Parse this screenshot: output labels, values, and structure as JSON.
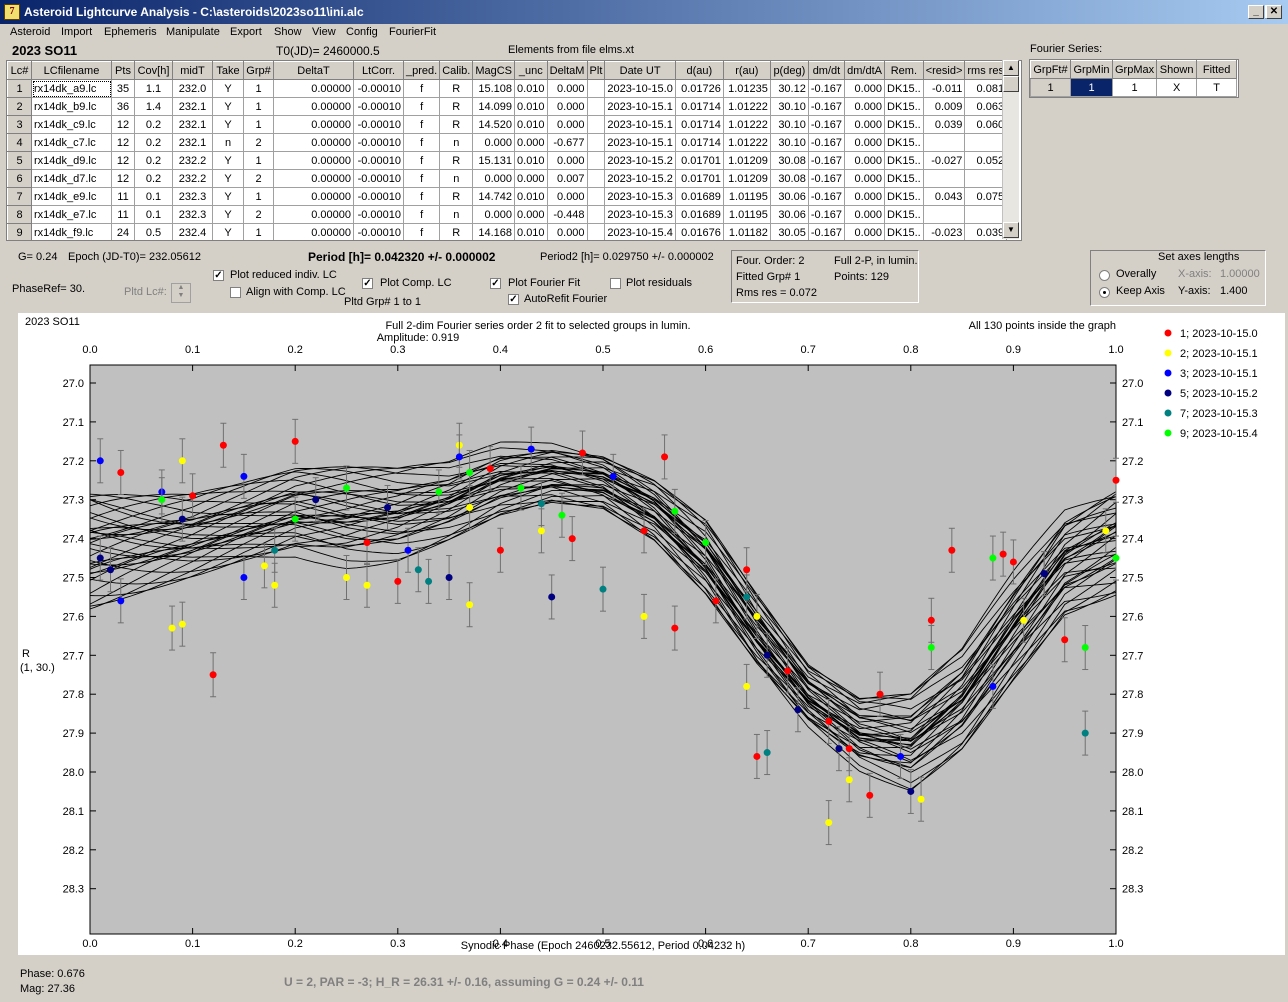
{
  "window": {
    "title": "Asteroid Lightcurve Analysis - C:\\asteroids\\2023so11\\ini.alc",
    "icon_text": "7"
  },
  "menu": [
    "Asteroid",
    "Import",
    "Ephemeris",
    "Manipulate",
    "Export",
    "Show",
    "View",
    "Config",
    "FourierFit"
  ],
  "header": {
    "asteroid_name": "2023 SO11",
    "t0": "T0(JD)= 2460000.5",
    "elements": "Elements from file elms.xt"
  },
  "grid": {
    "columns": [
      "Lc#",
      "LCfilename",
      "Pts",
      "Cov[h]",
      "midT",
      "Take",
      "Grp#",
      "DeltaT",
      "LtCorr.",
      "_pred.",
      "Calib.",
      "MagCS",
      "_unc",
      "DeltaM",
      "Plt",
      "Date UT",
      "d(au)",
      "r(au)",
      "p(deg)",
      "dm/dt",
      "dm/dtA",
      "Rem.",
      "<resid>",
      "rms res"
    ],
    "rows": [
      [
        "1",
        "rx14dk_a9.lc",
        "35",
        "1.1",
        "232.0",
        "Y",
        "1",
        "0.00000",
        "-0.00010",
        "f",
        "R",
        "15.108",
        "0.010",
        "0.000",
        "",
        "2023-10-15.0",
        "0.01726",
        "1.01235",
        "30.12",
        "-0.167",
        "0.000",
        "DK15..",
        "-0.011",
        "0.081"
      ],
      [
        "2",
        "rx14dk_b9.lc",
        "36",
        "1.4",
        "232.1",
        "Y",
        "1",
        "0.00000",
        "-0.00010",
        "f",
        "R",
        "14.099",
        "0.010",
        "0.000",
        "",
        "2023-10-15.1",
        "0.01714",
        "1.01222",
        "30.10",
        "-0.167",
        "0.000",
        "DK15..",
        "0.009",
        "0.063"
      ],
      [
        "3",
        "rx14dk_c9.lc",
        "12",
        "0.2",
        "232.1",
        "Y",
        "1",
        "0.00000",
        "-0.00010",
        "f",
        "R",
        "14.520",
        "0.010",
        "0.000",
        "",
        "2023-10-15.1",
        "0.01714",
        "1.01222",
        "30.10",
        "-0.167",
        "0.000",
        "DK15..",
        "0.039",
        "0.060"
      ],
      [
        "4",
        "rx14dk_c7.lc",
        "12",
        "0.2",
        "232.1",
        "n",
        "2",
        "0.00000",
        "-0.00010",
        "f",
        "n",
        "0.000",
        "0.000",
        "-0.677",
        "",
        "2023-10-15.1",
        "0.01714",
        "1.01222",
        "30.10",
        "-0.167",
        "0.000",
        "DK15..",
        "",
        ""
      ],
      [
        "5",
        "rx14dk_d9.lc",
        "12",
        "0.2",
        "232.2",
        "Y",
        "1",
        "0.00000",
        "-0.00010",
        "f",
        "R",
        "15.131",
        "0.010",
        "0.000",
        "",
        "2023-10-15.2",
        "0.01701",
        "1.01209",
        "30.08",
        "-0.167",
        "0.000",
        "DK15..",
        "-0.027",
        "0.052"
      ],
      [
        "6",
        "rx14dk_d7.lc",
        "12",
        "0.2",
        "232.2",
        "Y",
        "2",
        "0.00000",
        "-0.00010",
        "f",
        "n",
        "0.000",
        "0.000",
        "0.007",
        "",
        "2023-10-15.2",
        "0.01701",
        "1.01209",
        "30.08",
        "-0.167",
        "0.000",
        "DK15..",
        "",
        ""
      ],
      [
        "7",
        "rx14dk_e9.lc",
        "11",
        "0.1",
        "232.3",
        "Y",
        "1",
        "0.00000",
        "-0.00010",
        "f",
        "R",
        "14.742",
        "0.010",
        "0.000",
        "",
        "2023-10-15.3",
        "0.01689",
        "1.01195",
        "30.06",
        "-0.167",
        "0.000",
        "DK15..",
        "0.043",
        "0.075"
      ],
      [
        "8",
        "rx14dk_e7.lc",
        "11",
        "0.1",
        "232.3",
        "Y",
        "2",
        "0.00000",
        "-0.00010",
        "f",
        "n",
        "0.000",
        "0.000",
        "-0.448",
        "",
        "2023-10-15.3",
        "0.01689",
        "1.01195",
        "30.06",
        "-0.167",
        "0.000",
        "DK15..",
        "",
        ""
      ],
      [
        "9",
        "rx14dk_f9.lc",
        "24",
        "0.5",
        "232.4",
        "Y",
        "1",
        "0.00000",
        "-0.00010",
        "f",
        "R",
        "14.168",
        "0.010",
        "0.000",
        "",
        "2023-10-15.4",
        "0.01676",
        "1.01182",
        "30.05",
        "-0.167",
        "0.000",
        "DK15..",
        "-0.023",
        "0.039"
      ]
    ]
  },
  "fourier_series": {
    "label": "Fourier Series:",
    "columns": [
      "GrpFt#",
      "GrpMin",
      "GrpMax",
      "Shown",
      "Fitted"
    ],
    "row": [
      "1",
      "1",
      "1",
      "X",
      "T"
    ]
  },
  "controls": {
    "g_value": "G= 0.24",
    "epoch": "Epoch (JD-T0)= 232.05612",
    "period": "Period [h]= 0.042320 +/- 0.000002",
    "period2": "Period2 [h]= 0.029750 +/- 0.000002",
    "phase_ref": "PhaseRef= 30.",
    "pltd_lc": "Pltd Lc#:",
    "plot_reduced": "Plot reduced indiv. LC",
    "align_comp": "Align with Comp. LC",
    "plot_comp": "Plot Comp. LC",
    "pltd_grp": "Pltd Grp#  1   to   1",
    "plot_fourier": "Plot Fourier Fit",
    "autorefit": "AutoRefit Fourier",
    "plot_residuals": "Plot residuals",
    "four_order": "Four. Order:  2",
    "full_2p": "Full 2-P, in lumin.",
    "fitted_grp": "Fitted Grp# 1",
    "points": "Points: 129",
    "rms_res": "Rms res      = 0.072"
  },
  "axes_box": {
    "title": "Set axes lengths",
    "overally": "Overally",
    "keep_axis": "Keep Axis",
    "x_axis_label": "X-axis:",
    "x_axis_value": "1.00000",
    "y_axis_label": "Y-axis:",
    "y_axis_value": "1.400"
  },
  "status": {
    "phase": "Phase:  0.676",
    "mag": "Mag:     27.36",
    "result": "U = 2, PAR = -3; H_R = 26.31 +/- 0.16, assuming G = 0.24 +/- 0.11"
  },
  "chart_data": {
    "type": "scatter",
    "title": "Full 2-dim Fourier series order 2 fit to selected groups in lumin.",
    "subtitle": "Amplitude: 0.919",
    "corner_left": "2023 SO11",
    "corner_right": "All 130 points inside the graph",
    "xlabel": "Synodic Phase (Epoch 2460232.55612, Period 0.04232 h)",
    "ylabel": "R",
    "ylabel2": "(1, 30.)",
    "xlim": [
      0,
      1
    ],
    "ylim": [
      26.9,
      28.4
    ],
    "y_inverted": true,
    "x_ticks": [
      "0.0",
      "0.1",
      "0.2",
      "0.3",
      "0.4",
      "0.5",
      "0.6",
      "0.7",
      "0.8",
      "0.9",
      "1.0"
    ],
    "y_ticks": [
      "27.0",
      "27.1",
      "27.2",
      "27.3",
      "27.4",
      "27.5",
      "27.6",
      "27.7",
      "27.8",
      "27.9",
      "28.0",
      "28.1",
      "28.2",
      "28.3"
    ],
    "legend_position": "right",
    "series": [
      {
        "name": "1; 2023-10-15.0",
        "color": "#ff0000",
        "points": [
          [
            0.12,
            27.75
          ],
          [
            0.13,
            27.16
          ],
          [
            0.2,
            27.15
          ],
          [
            0.1,
            27.29
          ],
          [
            0.03,
            27.23
          ],
          [
            0.56,
            27.19
          ],
          [
            0.54,
            27.38
          ],
          [
            0.57,
            27.63
          ],
          [
            0.64,
            27.48
          ],
          [
            0.65,
            27.96
          ],
          [
            0.68,
            27.74
          ],
          [
            0.72,
            27.87
          ],
          [
            0.74,
            27.94
          ],
          [
            0.76,
            28.06
          ],
          [
            0.84,
            27.43
          ],
          [
            0.82,
            27.61
          ],
          [
            0.89,
            27.44
          ],
          [
            0.9,
            27.46
          ],
          [
            0.95,
            27.66
          ],
          [
            1.0,
            27.25
          ],
          [
            0.39,
            27.22
          ],
          [
            0.4,
            27.43
          ],
          [
            0.27,
            27.41
          ],
          [
            0.3,
            27.51
          ],
          [
            0.48,
            27.18
          ],
          [
            0.47,
            27.4
          ],
          [
            0.77,
            27.8
          ],
          [
            0.61,
            27.56
          ]
        ]
      },
      {
        "name": "2; 2023-10-15.1",
        "color": "#ffff00",
        "points": [
          [
            0.08,
            27.63
          ],
          [
            0.09,
            27.62
          ],
          [
            0.17,
            27.47
          ],
          [
            0.18,
            27.52
          ],
          [
            0.37,
            27.57
          ],
          [
            0.37,
            27.32
          ],
          [
            0.36,
            27.16
          ],
          [
            0.54,
            27.6
          ],
          [
            0.64,
            27.78
          ],
          [
            0.65,
            27.6
          ],
          [
            0.72,
            28.13
          ],
          [
            0.74,
            28.02
          ],
          [
            0.81,
            28.07
          ],
          [
            0.99,
            27.38
          ],
          [
            0.91,
            27.61
          ],
          [
            0.44,
            27.38
          ],
          [
            0.25,
            27.5
          ],
          [
            0.27,
            27.52
          ],
          [
            0.09,
            27.2
          ]
        ]
      },
      {
        "name": "3; 2023-10-15.1",
        "color": "#0000ff",
        "points": [
          [
            0.01,
            27.2
          ],
          [
            0.07,
            27.28
          ],
          [
            0.15,
            27.24
          ],
          [
            0.36,
            27.19
          ],
          [
            0.43,
            27.17
          ],
          [
            0.51,
            27.24
          ],
          [
            0.79,
            27.96
          ],
          [
            0.88,
            27.78
          ],
          [
            0.93,
            27.49
          ],
          [
            0.03,
            27.56
          ],
          [
            0.31,
            27.43
          ],
          [
            0.15,
            27.5
          ]
        ]
      },
      {
        "name": "5; 2023-10-15.2",
        "color": "#000080",
        "points": [
          [
            0.01,
            27.45
          ],
          [
            0.02,
            27.48
          ],
          [
            0.09,
            27.35
          ],
          [
            0.29,
            27.32
          ],
          [
            0.35,
            27.5
          ],
          [
            0.45,
            27.55
          ],
          [
            0.66,
            27.7
          ],
          [
            0.69,
            27.84
          ],
          [
            0.73,
            27.94
          ],
          [
            0.8,
            28.05
          ],
          [
            0.93,
            27.49
          ],
          [
            0.22,
            27.3
          ]
        ]
      },
      {
        "name": "7; 2023-10-15.3",
        "color": "#008080",
        "points": [
          [
            0.32,
            27.48
          ],
          [
            0.33,
            27.51
          ],
          [
            0.5,
            27.53
          ],
          [
            0.64,
            27.55
          ],
          [
            0.66,
            27.95
          ],
          [
            0.97,
            27.9
          ],
          [
            0.18,
            27.43
          ],
          [
            0.44,
            27.31
          ]
        ]
      },
      {
        "name": "9; 2023-10-15.4",
        "color": "#00ff00",
        "points": [
          [
            0.25,
            27.27
          ],
          [
            0.34,
            27.28
          ],
          [
            0.42,
            27.27
          ],
          [
            0.57,
            27.33
          ],
          [
            0.6,
            27.41
          ],
          [
            0.82,
            27.68
          ],
          [
            0.88,
            27.45
          ],
          [
            0.97,
            27.68
          ],
          [
            1.0,
            27.45
          ],
          [
            0.2,
            27.35
          ],
          [
            0.07,
            27.3
          ],
          [
            0.46,
            27.34
          ],
          [
            0.37,
            27.23
          ]
        ]
      }
    ],
    "fit_band": {
      "phase": [
        0.0,
        0.05,
        0.1,
        0.15,
        0.2,
        0.25,
        0.3,
        0.35,
        0.4,
        0.45,
        0.5,
        0.55,
        0.6,
        0.65,
        0.7,
        0.75,
        0.8,
        0.85,
        0.9,
        0.95,
        1.0
      ],
      "upper": [
        27.22,
        27.24,
        27.25,
        27.23,
        27.2,
        27.2,
        27.21,
        27.2,
        27.15,
        27.14,
        27.16,
        27.22,
        27.32,
        27.52,
        27.71,
        27.8,
        27.79,
        27.68,
        27.48,
        27.3,
        27.22
      ],
      "lower": [
        27.62,
        27.58,
        27.54,
        27.5,
        27.47,
        27.48,
        27.46,
        27.41,
        27.35,
        27.32,
        27.34,
        27.43,
        27.58,
        27.76,
        27.9,
        28.0,
        28.05,
        27.95,
        27.78,
        27.62,
        27.58
      ]
    }
  }
}
